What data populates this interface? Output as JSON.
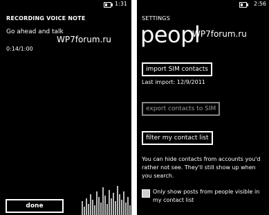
{
  "left_screen": {
    "status": {
      "time": "1:31",
      "battery_icon": "battery-icon"
    },
    "title": "RECORDING VOICE NOTE",
    "prompt": "Go ahead and talk",
    "elapsed": "0:14/1:00",
    "watermark": "WP7forum.ru",
    "done_label": "done"
  },
  "right_screen": {
    "status": {
      "time": "2:56",
      "battery_icon": "battery-icon"
    },
    "title": "SETTINGS",
    "pivot_header": "peopl",
    "watermark": "WP7forum.ru",
    "import_label": "import SIM contacts",
    "last_import": "Last import: 12/9/2011",
    "export_label": "export contacts to SIM",
    "filter_label": "filter my contact list",
    "hide_text": "You can hide contacts from accounts you'd rather not see. They'll still show up when you search.",
    "only_posts_label": "Only show posts from people visible in my contact list",
    "only_posts_checked": false
  }
}
